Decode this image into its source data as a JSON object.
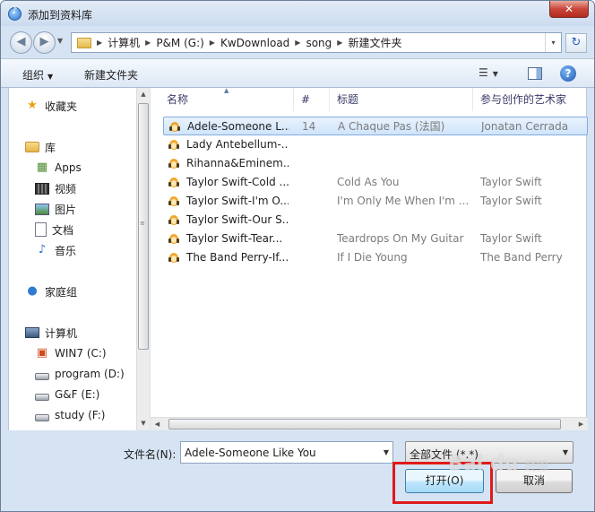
{
  "window": {
    "title": "添加到资料库",
    "close_label": "✕"
  },
  "address_bar": {
    "path": [
      "计算机",
      "P&M (G:)",
      "KwDownload",
      "song",
      "新建文件夹"
    ],
    "dropdown_glyph": "▾"
  },
  "toolbar": {
    "organize_label": "组织",
    "new_folder_label": "新建文件夹",
    "help_label": "?"
  },
  "nav_pane": {
    "favorites": "收藏夹",
    "libraries": "库",
    "library_items": [
      "Apps",
      "视频",
      "图片",
      "文档",
      "音乐"
    ],
    "homegroup": "家庭组",
    "computer": "计算机",
    "drives": [
      "WIN7 (C:)",
      "program (D:)",
      "G&F (E:)",
      "study (F:)"
    ]
  },
  "file_list": {
    "columns": [
      "名称",
      "#",
      "标题",
      "参与创作的艺术家"
    ],
    "rows": [
      {
        "name": "Adele-Someone L...",
        "num": "14",
        "title": "A Chaque Pas (法国)",
        "artist": "Jonatan Cerrada",
        "selected": true
      },
      {
        "name": "Lady Antebellum-...",
        "num": "",
        "title": "",
        "artist": "",
        "selected": false
      },
      {
        "name": "Rihanna&Eminem...",
        "num": "",
        "title": "",
        "artist": "",
        "selected": false
      },
      {
        "name": "Taylor Swift-Cold ...",
        "num": "",
        "title": "Cold As You",
        "artist": "Taylor Swift",
        "selected": false
      },
      {
        "name": "Taylor Swift-I'm O...",
        "num": "",
        "title": "I'm Only Me When I'm ...",
        "artist": "Taylor Swift",
        "selected": false
      },
      {
        "name": "Taylor Swift-Our S...",
        "num": "",
        "title": "",
        "artist": "",
        "selected": false
      },
      {
        "name": "Taylor Swift-Tear...",
        "num": "",
        "title": "Teardrops On My Guitar",
        "artist": "Taylor Swift",
        "selected": false
      },
      {
        "name": "The Band Perry-If...",
        "num": "",
        "title": "If I Die Young",
        "artist": "The Band Perry",
        "selected": false
      }
    ]
  },
  "footer": {
    "filename_label": "文件名(N):",
    "filename_value": "Adele-Someone Like You",
    "filetype_value": "全部文件 (*.*)",
    "open_label": "打开(O)",
    "cancel_label": "取消"
  },
  "watermark": {
    "brand": "Bai du",
    "suffix": "经验"
  },
  "colors": {
    "highlight": "#e11919",
    "selection": "#cfe4fb",
    "accent": "#2a63b5"
  }
}
